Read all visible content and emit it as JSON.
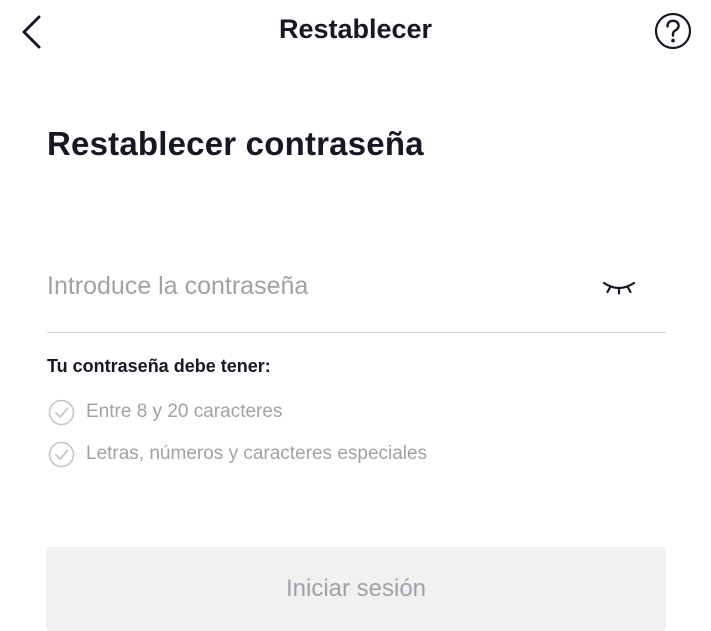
{
  "header": {
    "title": "Restablecer",
    "back_icon": "chevron-left-icon",
    "help_icon": "question-circle-icon"
  },
  "page_title": "Restablecer contraseña",
  "password": {
    "placeholder": "Introduce la contraseña",
    "value": "",
    "visibility_icon": "eye-closed-icon"
  },
  "requirements": {
    "title": "Tu contraseña debe tener:",
    "items": [
      {
        "label": "Entre 8 y 20 caracteres",
        "met": false
      },
      {
        "label": "Letras, números y caracteres especiales",
        "met": false
      }
    ]
  },
  "login_button": {
    "label": "Iniciar sesión",
    "enabled": false
  },
  "colors": {
    "text_primary": "#161823",
    "text_muted": "#a1a2a7",
    "divider": "#d6d6d9",
    "button_disabled_bg": "#f1f1f2"
  }
}
